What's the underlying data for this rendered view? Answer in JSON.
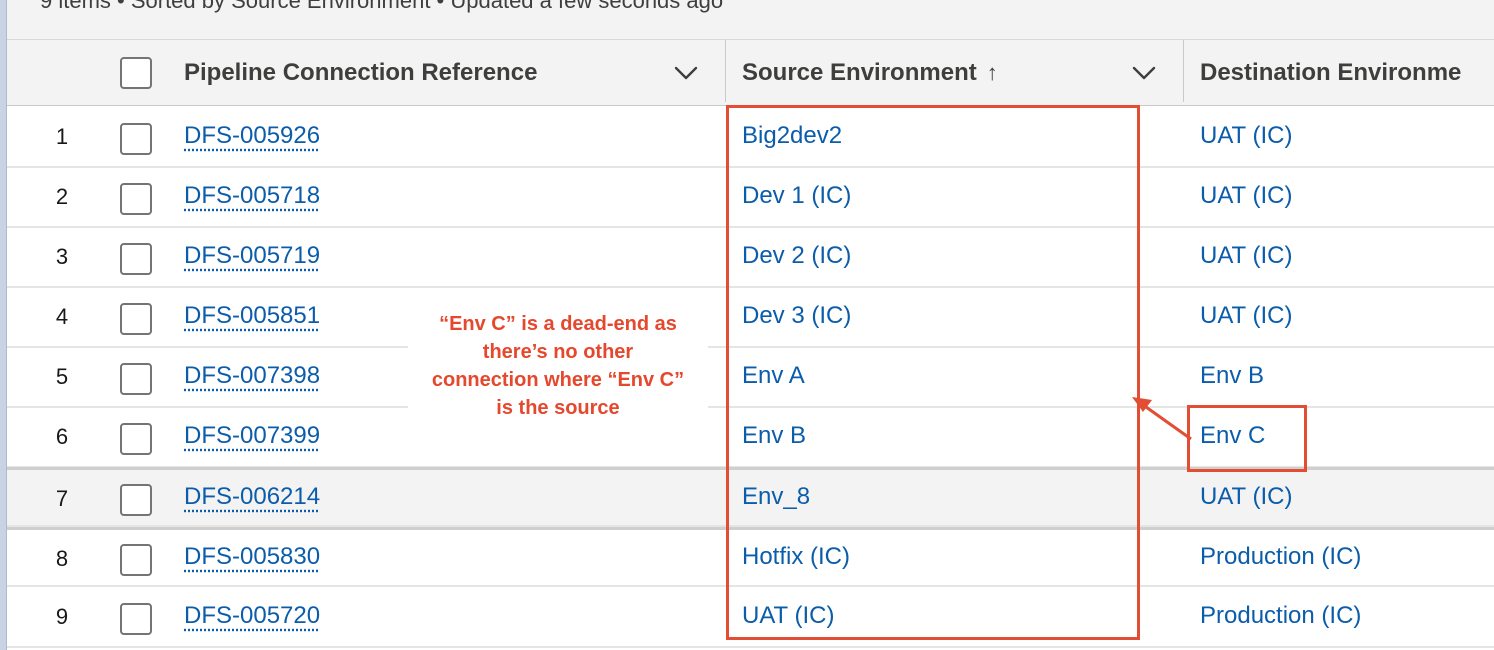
{
  "status_bar": {
    "text": "9 items • Sorted by Source Environment • Updated a few seconds ago"
  },
  "columns": [
    {
      "label": "Pipeline Connection Reference"
    },
    {
      "label": "Source Environment"
    },
    {
      "label": "Destination Environme"
    }
  ],
  "sort_indicator": "↑",
  "icons": {
    "sort": "arrow-up-icon",
    "menu": "chevron-down-icon"
  },
  "rows": [
    {
      "num": "1",
      "ref": "DFS-005926",
      "source": "Big2dev2",
      "destination": "UAT (IC)"
    },
    {
      "num": "2",
      "ref": "DFS-005718",
      "source": "Dev 1 (IC)",
      "destination": "UAT (IC)"
    },
    {
      "num": "3",
      "ref": "DFS-005719",
      "source": "Dev 2 (IC)",
      "destination": "UAT (IC)"
    },
    {
      "num": "4",
      "ref": "DFS-005851",
      "source": "Dev 3 (IC)",
      "destination": "UAT (IC)"
    },
    {
      "num": "5",
      "ref": "DFS-007398",
      "source": "Env A",
      "destination": "Env B"
    },
    {
      "num": "6",
      "ref": "DFS-007399",
      "source": "Env B",
      "destination": "Env C"
    },
    {
      "num": "7",
      "ref": "DFS-006214",
      "source": "Env_8",
      "destination": "UAT (IC)"
    },
    {
      "num": "8",
      "ref": "DFS-005830",
      "source": "Hotfix (IC)",
      "destination": "Production (IC)"
    },
    {
      "num": "9",
      "ref": "DFS-005720",
      "source": "UAT (IC)",
      "destination": "Production (IC)"
    }
  ],
  "annotation": {
    "lines": [
      "“Env C” is a dead-end as",
      "there’s no other",
      "connection where “Env C”",
      "is the source"
    ],
    "color": "#e34d33"
  },
  "colors": {
    "link": "#0b5cab",
    "header_bg": "#f3f3f3",
    "highlight": "#e34d33"
  }
}
